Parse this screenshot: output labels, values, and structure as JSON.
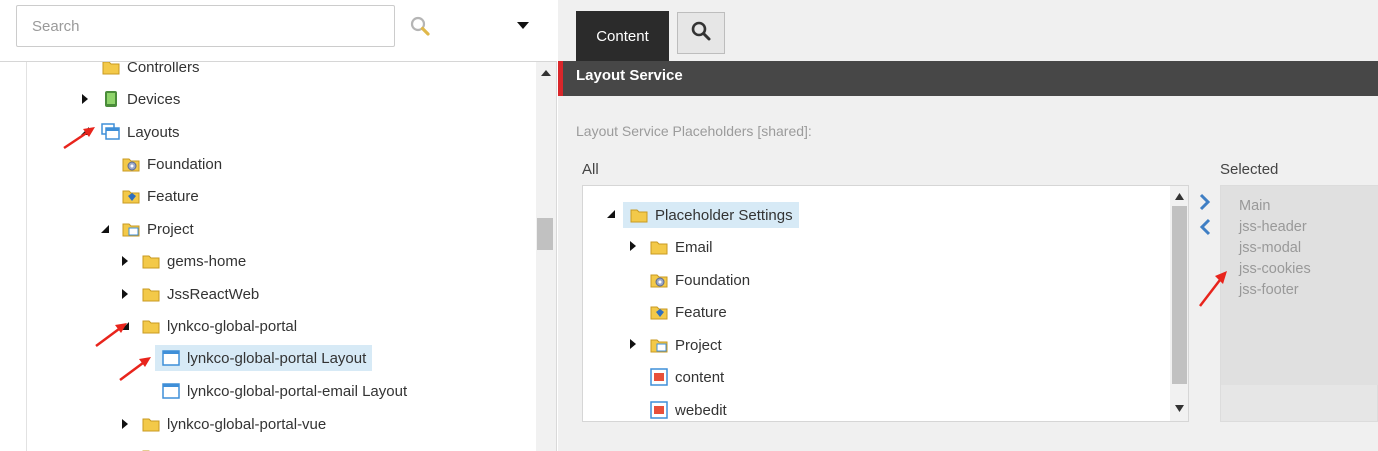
{
  "search": {
    "placeholder": "Search"
  },
  "tree": [
    {
      "label": "Controllers",
      "icon": "folder-icon",
      "toggle": "none"
    },
    {
      "label": "Devices",
      "icon": "device-icon",
      "toggle": "collapsed"
    },
    {
      "label": "Layouts",
      "icon": "layouts-icon",
      "toggle": "expanded"
    },
    {
      "label": "Foundation",
      "icon": "folder-gear-icon",
      "toggle": "none"
    },
    {
      "label": "Feature",
      "icon": "folder-feature-icon",
      "toggle": "none"
    },
    {
      "label": "Project",
      "icon": "folder-project-icon",
      "toggle": "expanded"
    },
    {
      "label": "gems-home",
      "icon": "folder-icon",
      "toggle": "collapsed"
    },
    {
      "label": "JssReactWeb",
      "icon": "folder-icon",
      "toggle": "collapsed"
    },
    {
      "label": "lynkco-global-portal",
      "icon": "folder-icon",
      "toggle": "expanded"
    },
    {
      "label": "lynkco-global-portal Layout",
      "icon": "layout-icon",
      "toggle": "none",
      "selected": true
    },
    {
      "label": "lynkco-global-portal-email Layout",
      "icon": "layout-icon",
      "toggle": "none"
    },
    {
      "label": "lynkco-global-portal-vue",
      "icon": "folder-icon",
      "toggle": "collapsed"
    }
  ],
  "tabs": {
    "content": "Content"
  },
  "section": {
    "title": "Layout Service"
  },
  "field": {
    "label": "Layout Service Placeholders [shared]:",
    "all_label": "All",
    "selected_label": "Selected"
  },
  "all_tree": [
    {
      "label": "Placeholder Settings",
      "icon": "folder-icon",
      "toggle": "expanded",
      "selected": true
    },
    {
      "label": "Email",
      "icon": "folder-icon",
      "toggle": "collapsed"
    },
    {
      "label": "Foundation",
      "icon": "folder-gear-icon",
      "toggle": "none"
    },
    {
      "label": "Feature",
      "icon": "folder-feature-icon",
      "toggle": "none"
    },
    {
      "label": "Project",
      "icon": "folder-project-icon",
      "toggle": "collapsed"
    },
    {
      "label": "content",
      "icon": "placeholder-icon",
      "toggle": "none"
    },
    {
      "label": "webedit",
      "icon": "placeholder-icon",
      "toggle": "none"
    }
  ],
  "selected_items": [
    "Main",
    "jss-header",
    "jss-modal",
    "jss-cookies",
    "jss-footer"
  ],
  "colors": {
    "accent_red": "#d9262a",
    "section_bg": "#474747",
    "tab_bg": "#2b2b2b",
    "selection": "#d7eaf6"
  }
}
